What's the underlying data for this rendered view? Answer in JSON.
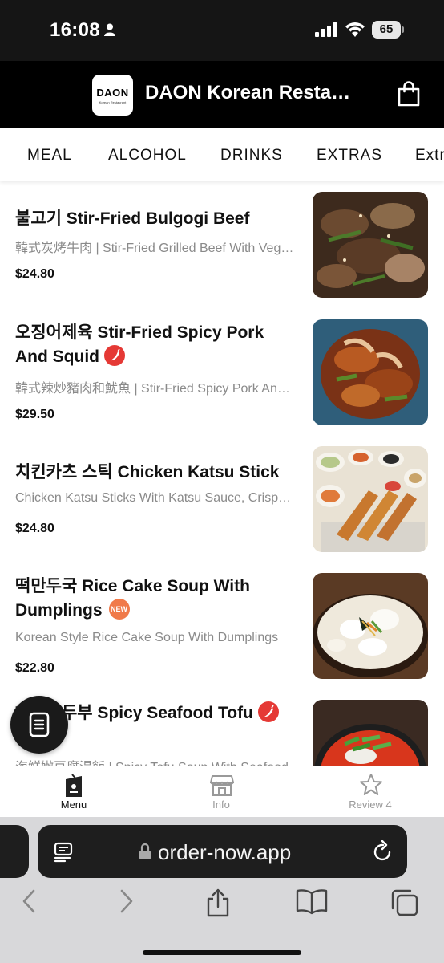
{
  "status_bar": {
    "time": "16:08",
    "battery": "65"
  },
  "header": {
    "logo_text": "DAON",
    "logo_sub": "Korean Restaurant",
    "title": "DAON Korean Restaurant"
  },
  "tabs": [
    "MEAL",
    "ALCOHOL",
    "DRINKS",
    "EXTRAS",
    "Extras"
  ],
  "menu_items": [
    {
      "name": "불고기 Stir-Fried Bulgogi Beef",
      "desc": "韓式炭烤牛肉 | Stir-Fried Grilled Beef With Vegetables",
      "price": "$24.80"
    },
    {
      "name": "오징어제육 Stir-Fried Spicy Pork And Squid",
      "desc": "韓式辣炒豬肉和魷魚 | Stir-Fried Spicy Pork And Squid",
      "price": "$29.50",
      "badge": "spicy"
    },
    {
      "name": "치킨카츠 스틱 Chicken Katsu Stick",
      "desc": "Chicken Katsu Sticks With Katsu Sauce, Crispy Fried",
      "price": "$24.80"
    },
    {
      "name": "떡만두국 Rice Cake Soup With Dumplings",
      "desc": "Korean Style Rice Cake Soup With Dumplings",
      "price": "$22.80",
      "badge_text": "NEW"
    },
    {
      "name": "해물순두부 Spicy Seafood Tofu",
      "desc": "海鮮嫩豆腐湯飯 | Spicy Tofu Soup With Seafood",
      "price": "",
      "badge": "spicy"
    }
  ],
  "bottom_nav": [
    {
      "label": "Menu",
      "icon": "menu-book-icon",
      "active": true
    },
    {
      "label": "Info",
      "icon": "store-icon",
      "active": false
    },
    {
      "label": "Review 4",
      "icon": "star-icon",
      "active": false
    }
  ],
  "browser": {
    "url": "order-now.app"
  },
  "colors": {
    "header_bg": "#000000",
    "spicy": "#e53935",
    "new_badge": "#f07a4a"
  }
}
